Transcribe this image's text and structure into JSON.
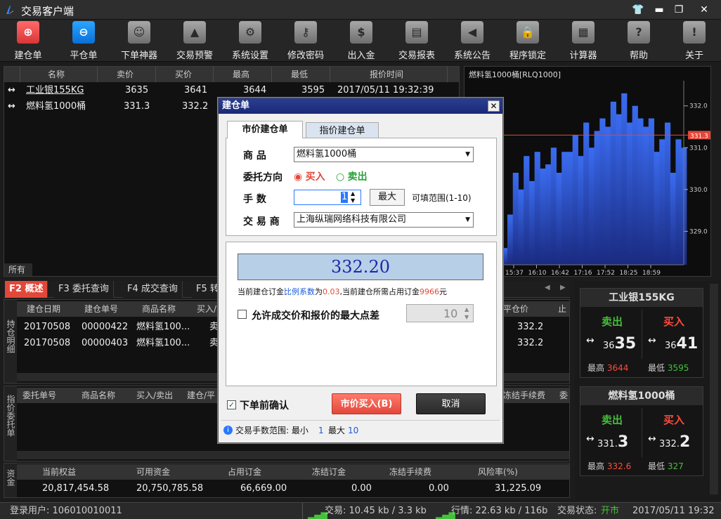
{
  "app": {
    "title": "交易客户端",
    "window_buttons": [
      "👕",
      "▬",
      "❐",
      "✕"
    ]
  },
  "toolbar": [
    {
      "label": "建仓单",
      "icon": "plus-circle-icon",
      "glyph": "⊕",
      "style": "red"
    },
    {
      "label": "平仓单",
      "icon": "minus-circle-icon",
      "glyph": "⊖",
      "style": "blue"
    },
    {
      "label": "下单神器",
      "icon": "robot-icon",
      "glyph": "☺",
      "style": ""
    },
    {
      "label": "交易预警",
      "icon": "warning-icon",
      "glyph": "▲",
      "style": ""
    },
    {
      "label": "系统设置",
      "icon": "gear-icon",
      "glyph": "⚙",
      "style": ""
    },
    {
      "label": "修改密码",
      "icon": "key-icon",
      "glyph": "⚷",
      "style": ""
    },
    {
      "label": "出入金",
      "icon": "money-bag-icon",
      "glyph": "$",
      "style": ""
    },
    {
      "label": "交易报表",
      "icon": "report-icon",
      "glyph": "▤",
      "style": ""
    },
    {
      "label": "系统公告",
      "icon": "speaker-icon",
      "glyph": "◀",
      "style": ""
    },
    {
      "label": "程序锁定",
      "icon": "lock-icon",
      "glyph": "🔒",
      "style": ""
    },
    {
      "label": "计算器",
      "icon": "calculator-icon",
      "glyph": "▦",
      "style": ""
    },
    {
      "label": "帮助",
      "icon": "question-icon",
      "glyph": "?",
      "style": ""
    },
    {
      "label": "关于",
      "icon": "info-icon",
      "glyph": "!",
      "style": ""
    }
  ],
  "quotes": {
    "columns": [
      "名称",
      "卖价",
      "买价",
      "最高",
      "最低",
      "报价时间"
    ],
    "rows": [
      {
        "name": "工业银155KG",
        "sell": "3635",
        "buy": "3641",
        "high": "3644",
        "low": "3595",
        "time": "2017/05/11 19:32:39"
      },
      {
        "name": "燃料氢1000桶",
        "sell": "331.3",
        "buy": "332.2",
        "high": "",
        "low": "",
        "time": ""
      }
    ],
    "category_tab": "所有"
  },
  "chart": {
    "title": "燃料氢1000桶[RLQ1000]",
    "current_label": "331.3",
    "chart_data": {
      "type": "area",
      "title": "燃料氢1000桶[RLQ1000]",
      "x_ticks": [
        "15:37",
        "16:10",
        "16:42",
        "17:16",
        "17:52",
        "18:25",
        "18:59"
      ],
      "y_ticks": [
        "332.0",
        "331.0",
        "330.0",
        "329.0"
      ],
      "ylim": [
        328.2,
        332.6
      ],
      "current": 331.3,
      "values": [
        329.2,
        329.6,
        329.0,
        328.6,
        329.4,
        330.4,
        330.0,
        330.8,
        330.2,
        330.9,
        330.5,
        330.6,
        331.0,
        330.4,
        330.9,
        330.9,
        331.3,
        330.8,
        331.6,
        331.0,
        331.4,
        331.7,
        331.5,
        332.1,
        331.8,
        332.3,
        331.6,
        332.0,
        331.7,
        331.5,
        331.7,
        330.9,
        331.2,
        331.6,
        330.4,
        331.2,
        331.0
      ]
    }
  },
  "function_tabs": [
    {
      "label": "F2 概述",
      "active": true
    },
    {
      "label": "F3 委托查询",
      "active": false
    },
    {
      "label": "F4 成交查询",
      "active": false
    },
    {
      "label": "F5 转",
      "active": false
    }
  ],
  "positions": {
    "side_label": "持仓明细",
    "columns": [
      "建仓日期",
      "建仓单号",
      "商品名称",
      "买入/"
    ],
    "rows": [
      {
        "date": "20170508",
        "no": "00000422",
        "product": "燃料氢100...",
        "dir": "卖",
        "close": "332.2"
      },
      {
        "date": "20170508",
        "no": "00000403",
        "product": "燃料氢100...",
        "dir": "卖",
        "close": "332.2"
      }
    ],
    "right_columns": [
      "平仓价",
      "止"
    ]
  },
  "orders": {
    "side_label": "指价委托单",
    "columns": [
      "委托单号",
      "商品名称",
      "买入/卖出",
      "建仓/平"
    ],
    "right_columns": [
      "冻结手续费",
      "委"
    ]
  },
  "funds": {
    "side_label": "资金",
    "columns": [
      "当前权益",
      "可用资金",
      "占用订金",
      "冻结订金",
      "冻结手续费",
      "风险率(%)"
    ],
    "values": [
      "20,817,454.58",
      "20,750,785.58",
      "66,669.00",
      "0.00",
      "0.00",
      "31,225.09"
    ]
  },
  "cards": [
    {
      "name": "工业银155KG",
      "sell_label": "卖出",
      "buy_label": "买入",
      "sell_small": "36",
      "sell_big": "35",
      "buy_small": "36",
      "buy_big": "41",
      "high_label": "最高",
      "high": "3644",
      "low_label": "最低",
      "low": "3595"
    },
    {
      "name": "燃料氢1000桶",
      "sell_label": "卖出",
      "buy_label": "买入",
      "sell_small": "331.",
      "sell_big": "3",
      "buy_small": "332.",
      "buy_big": "2",
      "high_label": "最高",
      "high": "332.6",
      "low_label": "最低",
      "low": "327"
    }
  ],
  "status": {
    "user": "登录用户: 106010010011",
    "traffic1": "交易: 10.45 kb / 3.3 kb",
    "traffic2": "行情: 22.63 kb / 116b",
    "state_label": "交易状态:",
    "state_value": "开市",
    "datetime": "2017/05/11 19:32"
  },
  "dialog": {
    "title": "建仓单",
    "tabs": [
      "市价建仓单",
      "指价建仓单"
    ],
    "product_label": "商    品",
    "product_value": "燃料氢1000桶",
    "direction_label": "委托方向",
    "buy_label": "买入",
    "sell_label": "卖出",
    "qty_label": "手    数",
    "qty_value": "1",
    "max_button": "最大",
    "range_text": "可填范围(1-10)",
    "dealer_label": "交 易 商",
    "dealer_value": "上海纵瑞网络科技有限公司",
    "price": "332.20",
    "margin_pre": "当前建仓订金",
    "margin_link": "比例系数",
    "margin_mid": "为",
    "margin_ratio": "0.03",
    "margin_post": ",当前建仓所需占用订金",
    "margin_amount": "9966",
    "margin_unit": "元",
    "slippage_label": "允许成交价和报价的最大点差",
    "slippage_value": "10",
    "confirm_label": "下单前确认",
    "submit_button": "市价买入(B)",
    "cancel_button": "取消",
    "fee_range_label": "交易手数范围: 最小",
    "fee_min": "1",
    "fee_max_label": "最大",
    "fee_max": "10"
  },
  "colors": {
    "red": "#e2483a",
    "green": "#45c03b",
    "blue": "#2a78ff",
    "chart_fill": "#2f5fe0"
  }
}
